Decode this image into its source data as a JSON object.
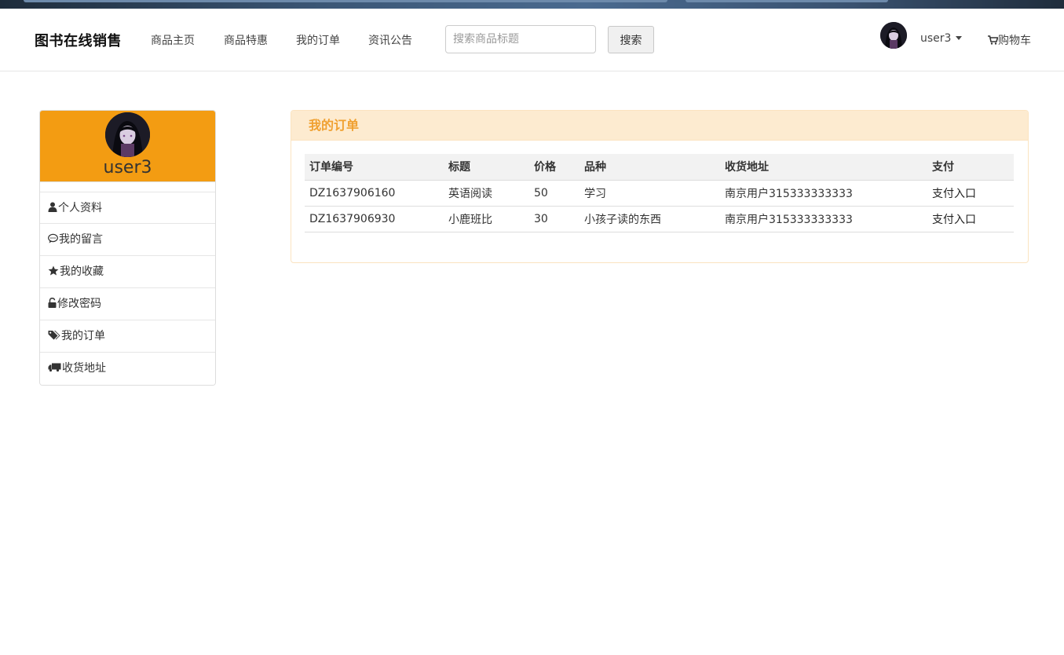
{
  "brand": "图书在线销售",
  "nav": [
    {
      "label": "商品主页"
    },
    {
      "label": "商品特惠"
    },
    {
      "label": "我的订单"
    },
    {
      "label": "资讯公告"
    }
  ],
  "search": {
    "placeholder": "搜索商品标题",
    "value": "",
    "button_label": "搜索"
  },
  "user": {
    "name": "user3",
    "avatar_icon": "user-avatar"
  },
  "cart": {
    "label": "购物车",
    "icon": "cart-icon"
  },
  "sidebar": {
    "header_color": "#f39c12",
    "items": [
      {
        "label": "个人资料",
        "icon": "user-icon"
      },
      {
        "label": "我的留言",
        "icon": "comment-icon"
      },
      {
        "label": "我的收藏",
        "icon": "star-icon"
      },
      {
        "label": "修改密码",
        "icon": "unlock-icon"
      },
      {
        "label": "我的订单",
        "icon": "tags-icon"
      },
      {
        "label": "收货地址",
        "icon": "truck-icon"
      }
    ]
  },
  "orders_panel": {
    "title": "我的订单",
    "columns": [
      "订单编号",
      "标题",
      "价格",
      "品种",
      "收货地址",
      "支付"
    ],
    "rows": [
      {
        "id": "DZ1637906160",
        "title": "英语阅读",
        "price": "50",
        "category": "学习",
        "address": "南京用户315333333333",
        "pay": "支付入口"
      },
      {
        "id": "DZ1637906930",
        "title": "小鹿班比",
        "price": "30",
        "category": "小孩子读的东西",
        "address": "南京用户315333333333",
        "pay": "支付入口"
      }
    ]
  }
}
